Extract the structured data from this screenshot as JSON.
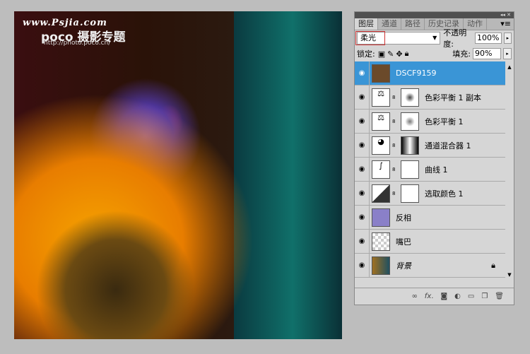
{
  "watermark": {
    "site": "www.Psjia.com",
    "brand": "poco 摄影专题",
    "url": "http://photo.poco.cn/"
  },
  "panel": {
    "tabs": [
      "图层",
      "通道",
      "路径",
      "历史记录",
      "动作"
    ],
    "blend_mode": "柔光",
    "opacity_label": "不透明度:",
    "opacity": "100%",
    "lock_label": "锁定:",
    "fill_label": "填充:",
    "fill": "90%",
    "layers": [
      {
        "name": "DSCF9159",
        "selected": true
      },
      {
        "name": "色彩平衡 1 副本"
      },
      {
        "name": "色彩平衡 1"
      },
      {
        "name": "通道混合器 1"
      },
      {
        "name": "曲线 1"
      },
      {
        "name": "选取颜色 1"
      },
      {
        "name": "反相"
      },
      {
        "name": "嘴巴"
      },
      {
        "name": "背景",
        "locked": true
      }
    ],
    "footer_icons": [
      "link-icon",
      "fx-icon",
      "mask-icon",
      "adjustment-icon",
      "group-icon",
      "new-layer-icon",
      "trash-icon"
    ]
  }
}
